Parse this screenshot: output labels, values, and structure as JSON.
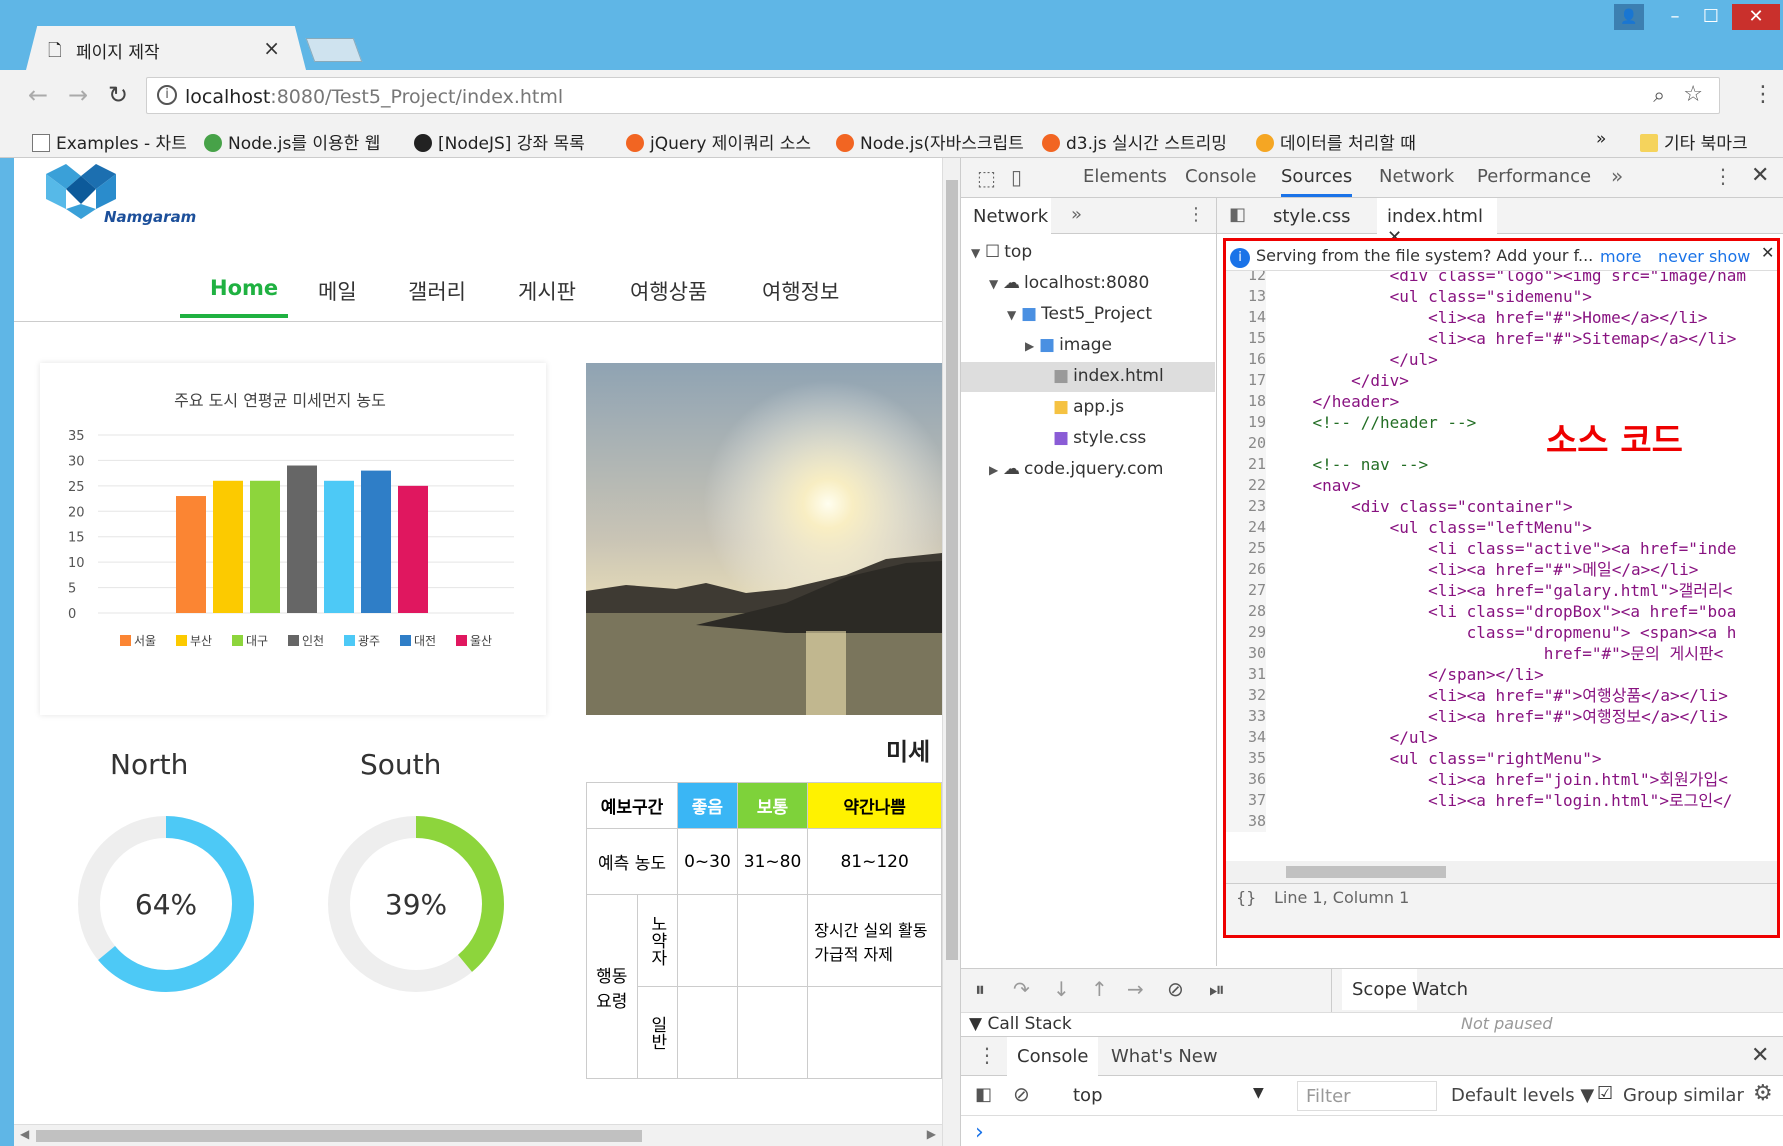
{
  "browser": {
    "tab_title": "페이지 제작",
    "tab_close": "×",
    "url_host": "localhost",
    "url_path": ":8080/Test5_Project/index.html",
    "bookmarks": [
      {
        "label": "Examples - 차트",
        "color": "#fff"
      },
      {
        "label": "Node.js를 이용한 웹",
        "color": "#47a248"
      },
      {
        "label": "[NodeJS] 강좌 목록",
        "color": "#222"
      },
      {
        "label": "jQuery 제이쿼리 소스",
        "color": "#f26522"
      },
      {
        "label": "Node.js(자바스크립트",
        "color": "#f26522"
      },
      {
        "label": "d3.js 실시간 스트리밍",
        "color": "#f26522"
      },
      {
        "label": "데이터를 처리할 때",
        "color": "#f5a623"
      }
    ],
    "bookmark_more": "»",
    "bookmark_folder": "기타 북마크"
  },
  "site": {
    "logo_text": "Namgaram",
    "menu": [
      "Home",
      "메일",
      "갤러리",
      "게시판",
      "여행상품",
      "여행정보"
    ],
    "active_menu": "Home",
    "accent": "#1fb141"
  },
  "chart_data": [
    {
      "type": "bar",
      "title": "주요 도시 연평균 미세먼지 농도",
      "categories": [
        "서울",
        "부산",
        "대구",
        "인천",
        "광주",
        "대전",
        "울산"
      ],
      "values": [
        23,
        26,
        26,
        29,
        26,
        28,
        25
      ],
      "colors": [
        "#fb8533",
        "#fcca00",
        "#8dd53c",
        "#666666",
        "#4dc9f6",
        "#2f7ec7",
        "#e0175f"
      ],
      "ylim": [
        0,
        35
      ],
      "yticks": [
        "35",
        "30",
        "25",
        "20",
        "15",
        "10",
        "5",
        "0"
      ],
      "grid": true,
      "legend": "bottom"
    },
    {
      "type": "pie",
      "title": "North",
      "value": 64,
      "label": "64%",
      "color": "#4dc9f6"
    },
    {
      "type": "pie",
      "title": "South",
      "value": 39,
      "label": "39%",
      "color": "#8dd53c"
    }
  ],
  "forecast": {
    "heading": "미세",
    "header": [
      "예보구간",
      "좋음",
      "보통",
      "약간나쁨"
    ],
    "header_colors": [
      "#fff",
      "#3ab6f5",
      "#7ed23a",
      "#fff200"
    ],
    "row1": [
      "예측 농도",
      "0~30",
      "31~80",
      "81~120"
    ],
    "row_group": "행동 요령",
    "sub1": "노약자",
    "sub1_text": "장시간 실외 활동 가급적 자제",
    "sub2": "일반"
  },
  "devtools": {
    "tabs": [
      "Elements",
      "Console",
      "Sources",
      "Network",
      "Performance"
    ],
    "active_tab": "Sources",
    "more": "»",
    "nav_tab": "Network",
    "file_tabs": [
      "style.css",
      "index.html"
    ],
    "tree": [
      "top",
      "localhost:8080",
      "Test5_Project",
      "image",
      "index.html",
      "app.js",
      "style.css",
      "code.jquery.com"
    ],
    "info": "Serving from the file system? Add your f...",
    "info_more": "more",
    "info_never": "never show",
    "annotation": "소스 코드",
    "status": "Line 1, Column 1",
    "debug_tabs": [
      "Scope",
      "Watch"
    ],
    "not_paused": "Not paused",
    "call_stack": "Call Stack",
    "drawer_tabs": [
      "Console",
      "What's New"
    ],
    "context": "top",
    "filter": "Filter",
    "levels": "Default levels ▼",
    "group_similar": "Group similar",
    "prompt": "›"
  },
  "code_lines": [
    {
      "n": "12",
      "t": "            <div class=\"logo\"><img src=\"image/nam"
    },
    {
      "n": "13",
      "t": "            <ul class=\"sidemenu\">"
    },
    {
      "n": "14",
      "t": "                <li><a href=\"#\">Home</a></li>"
    },
    {
      "n": "15",
      "t": "                <li><a href=\"#\">Sitemap</a></li>"
    },
    {
      "n": "16",
      "t": "            </ul>"
    },
    {
      "n": "17",
      "t": "        </div>"
    },
    {
      "n": "18",
      "t": "    </header>"
    },
    {
      "n": "19",
      "t": "    <!-- //header -->"
    },
    {
      "n": "20",
      "t": ""
    },
    {
      "n": "21",
      "t": "    <!-- nav -->"
    },
    {
      "n": "22",
      "t": "    <nav>"
    },
    {
      "n": "23",
      "t": "        <div class=\"container\">"
    },
    {
      "n": "24",
      "t": "            <ul class=\"leftMenu\">"
    },
    {
      "n": "25",
      "t": "                <li class=\"active\"><a href=\"inde"
    },
    {
      "n": "26",
      "t": "                <li><a href=\"#\">메일</a></li>"
    },
    {
      "n": "27",
      "t": "                <li><a href=\"galary.html\">갤러리<"
    },
    {
      "n": "28",
      "t": "                <li class=\"dropBox\"><a href=\"boa"
    },
    {
      "n": "29",
      "t": "                    class=\"dropmenu\"> <span><a h"
    },
    {
      "n": "30",
      "t": "                            href=\"#\">문의 게시판<"
    },
    {
      "n": "31",
      "t": "                </span></li>"
    },
    {
      "n": "32",
      "t": "                <li><a href=\"#\">여행상품</a></li>"
    },
    {
      "n": "33",
      "t": "                <li><a href=\"#\">여행정보</a></li>"
    },
    {
      "n": "34",
      "t": "            </ul>"
    },
    {
      "n": "35",
      "t": "            <ul class=\"rightMenu\">"
    },
    {
      "n": "36",
      "t": "                <li><a href=\"join.html\">회원가입<"
    },
    {
      "n": "37",
      "t": "                <li><a href=\"login.html\">로그인</"
    },
    {
      "n": "38",
      "t": ""
    }
  ]
}
